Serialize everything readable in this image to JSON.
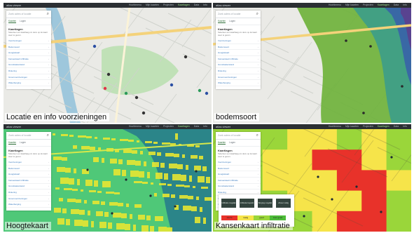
{
  "app": {
    "brand": "atlas viewer",
    "nav": [
      "Hoofdmenu",
      "Mijn kaarten",
      "Projecten",
      "Kaartlagen",
      "Data",
      "Info"
    ],
    "active_nav": "Kaartlagen"
  },
  "sidepanel": {
    "search_placeholder": "Zoek adres of locatie",
    "tabs": [
      "Kaarten",
      "Lagen"
    ],
    "title": "Kaartlagen",
    "description": "Selecteer een kaartlaag om deze op de kaart weer te geven.",
    "items": [
      "Voorzieningen",
      "Bodemsoort",
      "Hoogtekaart",
      "Kansenkaart infiltratie",
      "Grondwaterstand",
      "Riolering",
      "Groenvoorzieningen",
      "Waterberging"
    ]
  },
  "panels": [
    {
      "id": "p1",
      "caption": "Locatie en info voorzieningen",
      "kind": "voorzieningen"
    },
    {
      "id": "p2",
      "caption": "bodemsoort",
      "kind": "bodemsoort"
    },
    {
      "id": "p3",
      "caption": "Hoogtekaart",
      "kind": "hoogtekaart"
    },
    {
      "id": "p4",
      "caption": "Kansenkaart infiltratie",
      "kind": "kansenkaart"
    }
  ],
  "legend": {
    "buttons": [
      "Infiltratie mogelijk",
      "Infiltratie beperkt",
      "Berging mogelijk",
      "Afvoer nodig"
    ],
    "scale": [
      {
        "label": "slecht",
        "color": "#e8322a"
      },
      {
        "label": "matig",
        "color": "#f6e44a"
      },
      {
        "label": "goed",
        "color": "#9ad63a"
      },
      {
        "label": "zeer goed",
        "color": "#4dbb38"
      }
    ]
  },
  "colors": {
    "street_bg": "#eaeae6",
    "road_major": "#f4d27a",
    "water": "#9ec7dc",
    "park": "#b9dfae",
    "soil_green": "#6fb23c",
    "soil_teal": "#3c9d8a",
    "soil_blue": "#3862a8",
    "soil_purple": "#5d3f8e",
    "height_low": "#1f6f8f",
    "height_mid": "#4fc878",
    "height_high": "#e6e632",
    "kans_red": "#e8322a",
    "kans_yellow": "#f6e44a",
    "kans_green": "#9ad63a"
  }
}
